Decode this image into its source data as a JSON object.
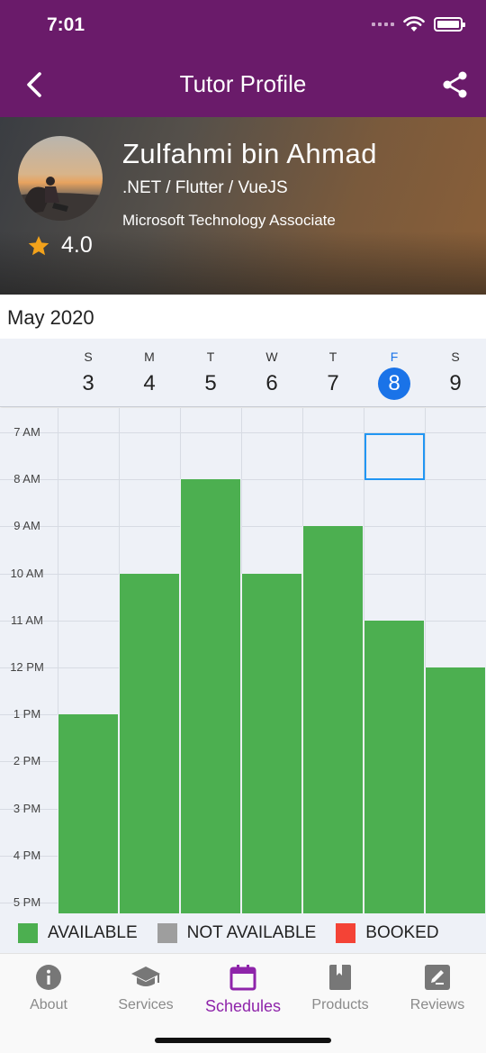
{
  "status": {
    "time": "7:01"
  },
  "appbar": {
    "title": "Tutor Profile",
    "back_icon": "chevron-left-icon",
    "share_icon": "share-icon"
  },
  "profile": {
    "name": "Zulfahmi bin Ahmad",
    "skills": ".NET / Flutter / VueJS",
    "certification": "Microsoft Technology Associate",
    "rating": "4.0"
  },
  "calendar": {
    "month": "May 2020",
    "days": [
      {
        "letter": "S",
        "num": "3"
      },
      {
        "letter": "M",
        "num": "4"
      },
      {
        "letter": "T",
        "num": "5"
      },
      {
        "letter": "W",
        "num": "6"
      },
      {
        "letter": "T",
        "num": "7"
      },
      {
        "letter": "F",
        "num": "8",
        "selected": true
      },
      {
        "letter": "S",
        "num": "9"
      }
    ],
    "hours": [
      "7 AM",
      "8 AM",
      "9 AM",
      "10 AM",
      "11 AM",
      "12 PM",
      "1 PM",
      "2 PM",
      "3 PM",
      "4 PM",
      "5 PM"
    ],
    "availability": [
      {
        "day": "3",
        "from": "1 PM",
        "to": "5 PM"
      },
      {
        "day": "4",
        "from": "10 AM",
        "to": "5 PM"
      },
      {
        "day": "5",
        "from": "8 AM",
        "to": "5 PM"
      },
      {
        "day": "6",
        "from": "10 AM",
        "to": "5 PM"
      },
      {
        "day": "7",
        "from": "9 AM",
        "to": "5 PM"
      },
      {
        "day": "8",
        "from": "11 AM",
        "to": "5 PM"
      },
      {
        "day": "9",
        "from": "12 PM",
        "to": "5 PM"
      }
    ],
    "highlighted_slot": {
      "day": "8",
      "hour": "7 AM"
    }
  },
  "legend": [
    {
      "label": "AVAILABLE",
      "color": "#4caf50"
    },
    {
      "label": "NOT AVAILABLE",
      "color": "#9e9e9e"
    },
    {
      "label": "BOOKED",
      "color": "#f44336"
    }
  ],
  "colors": {
    "brand": "#6a1b6a",
    "accent": "#8e24aa",
    "selected_day": "#1a73e8"
  },
  "nav": [
    {
      "label": "About",
      "icon": "info-icon"
    },
    {
      "label": "Services",
      "icon": "graduation-cap-icon"
    },
    {
      "label": "Schedules",
      "icon": "calendar-icon",
      "active": true
    },
    {
      "label": "Products",
      "icon": "book-icon"
    },
    {
      "label": "Reviews",
      "icon": "review-edit-icon"
    }
  ]
}
